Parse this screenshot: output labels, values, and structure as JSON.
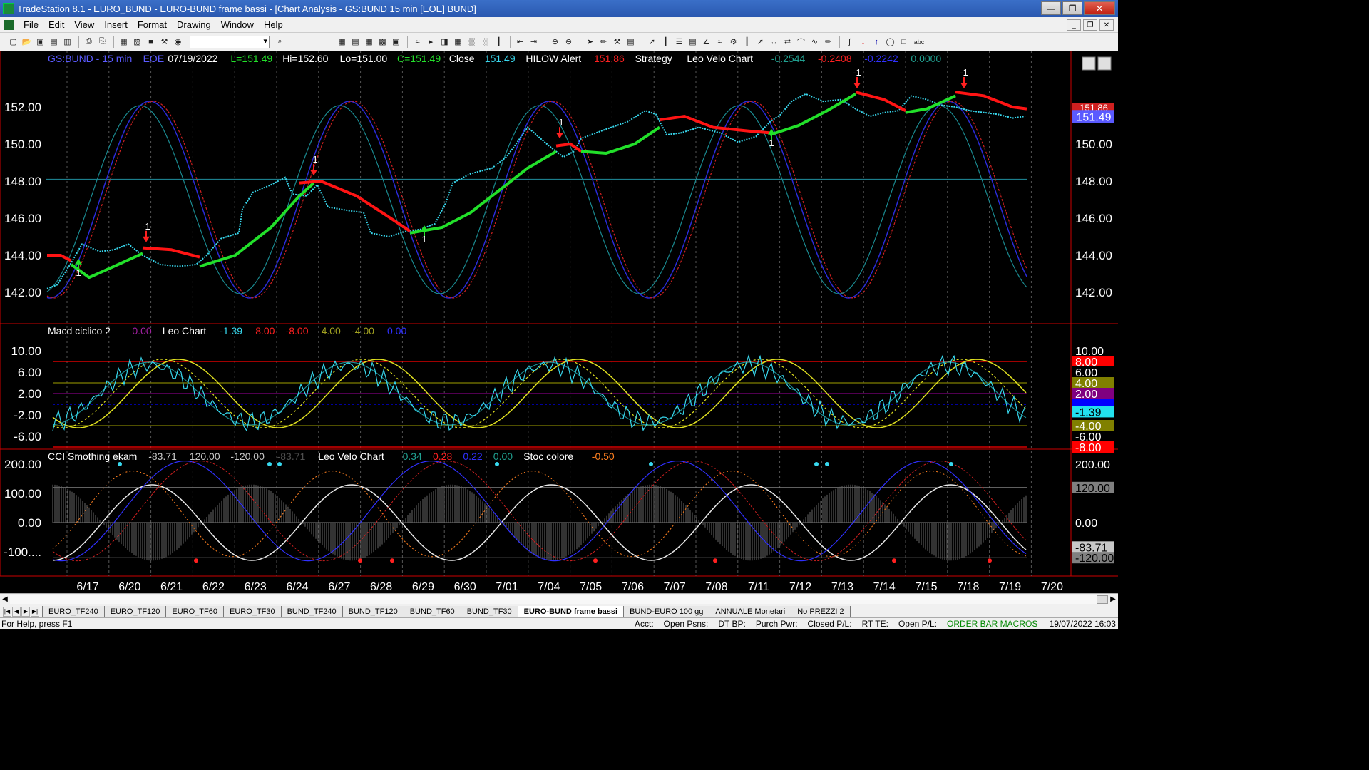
{
  "window": {
    "title": "TradeStation 8.1 - EURO_BUND - EURO-BUND frame bassi - [Chart Analysis - GS:BUND  15 min  [EOE] BUND]"
  },
  "menu": [
    "File",
    "Edit",
    "View",
    "Insert",
    "Format",
    "Drawing",
    "Window",
    "Help"
  ],
  "colors": {
    "price": "#38d8ee",
    "uptrend": "#22e02a",
    "downtrend": "#ff1414",
    "axis_text": "#ffffff",
    "panel_border": "#cc0000"
  },
  "price_panel": {
    "header": [
      {
        "text": "GS:BUND - 15 min",
        "color": "#5a5aff"
      },
      {
        "text": "EOE",
        "color": "#5a5aff"
      },
      {
        "text": "07/19/2022",
        "color": "#ffffff"
      },
      {
        "text": "L=151.49",
        "color": "#22e02a"
      },
      {
        "text": "Hi=152.60",
        "color": "#ffffff"
      },
      {
        "text": "Lo=151.00",
        "color": "#ffffff"
      },
      {
        "text": "C=151.49",
        "color": "#22e02a"
      },
      {
        "text": "Close",
        "color": "#ffffff"
      },
      {
        "text": "151.49",
        "color": "#38d8ee"
      },
      {
        "text": "HILOW Alert",
        "color": "#ffffff"
      },
      {
        "text": "151.86",
        "color": "#ff2020"
      },
      {
        "text": "Strategy",
        "color": "#ffffff"
      },
      {
        "text": "Leo Velo Chart",
        "color": "#ffffff"
      },
      {
        "text": "-0.2544",
        "color": "#20a090"
      },
      {
        "text": "-0.2408",
        "color": "#ff2020"
      },
      {
        "text": "-0.2242",
        "color": "#3030ff"
      },
      {
        "text": "0.0000",
        "color": "#20a090"
      }
    ],
    "y_ticks": [
      "152.00",
      "150.00",
      "148.00",
      "146.00",
      "144.00",
      "142.00"
    ],
    "last_price_tag": "151.49",
    "hidden_tag": "151.86"
  },
  "macd_panel": {
    "header": [
      {
        "text": "Macd ciclico 2",
        "color": "#ffffff"
      },
      {
        "text": "0.00",
        "color": "#a020a0"
      },
      {
        "text": "Leo Chart",
        "color": "#ffffff"
      },
      {
        "text": "-1.39",
        "color": "#38d8ee"
      },
      {
        "text": "8.00",
        "color": "#ff2020"
      },
      {
        "text": "-8.00",
        "color": "#ff2020"
      },
      {
        "text": "4.00",
        "color": "#a0a020"
      },
      {
        "text": "-4.00",
        "color": "#a0a020"
      },
      {
        "text": "0.00",
        "color": "#3030ff"
      }
    ],
    "y_ticks": [
      "10.00",
      "6.00",
      "2.00",
      "-2.00",
      "-6.00"
    ],
    "tags": [
      {
        "text": "10.00",
        "bg": "#000000",
        "fg": "#ffffff"
      },
      {
        "text": "8.00",
        "bg": "#ff0000",
        "fg": "#ffffff"
      },
      {
        "text": "6.00",
        "bg": "#000000",
        "fg": "#ffffff"
      },
      {
        "text": "4.00",
        "bg": "#808000",
        "fg": "#ffffff"
      },
      {
        "text": "2.00",
        "bg": "#800080",
        "fg": "#ffffff"
      },
      {
        "text": "0.00",
        "bg": "#0000ff",
        "fg": "#0000ff"
      },
      {
        "text": "-1.39",
        "bg": "#22e0ee",
        "fg": "#000000"
      },
      {
        "text": "-4.00",
        "bg": "#808000",
        "fg": "#ffffff"
      },
      {
        "text": "-6.00",
        "bg": "#000000",
        "fg": "#ffffff"
      },
      {
        "text": "-8.00",
        "bg": "#ff0000",
        "fg": "#ffffff"
      }
    ]
  },
  "cci_panel": {
    "header": [
      {
        "text": "CCI Smothing ekam",
        "color": "#ffffff"
      },
      {
        "text": "-83.71",
        "color": "#c8c8c8"
      },
      {
        "text": "120.00",
        "color": "#c8c8c8"
      },
      {
        "text": "-120.00",
        "color": "#c8c8c8"
      },
      {
        "text": "-83.71",
        "color": "#505050"
      },
      {
        "text": "Leo Velo Chart",
        "color": "#ffffff"
      },
      {
        "text": "0.34",
        "color": "#20a090"
      },
      {
        "text": "0.28",
        "color": "#ff2020"
      },
      {
        "text": "0.22",
        "color": "#3030ff"
      },
      {
        "text": "0.00",
        "color": "#20a090"
      },
      {
        "text": "Stoc colore",
        "color": "#ffffff"
      },
      {
        "text": "-0.50",
        "color": "#ff8020"
      }
    ],
    "y_ticks": [
      "200.00",
      "100.00",
      "0.00",
      "-100...."
    ],
    "tags": [
      {
        "text": "200.00",
        "bg": "#000000",
        "fg": "#ffffff"
      },
      {
        "text": "120.00",
        "bg": "#808080",
        "fg": "#000000"
      },
      {
        "text": "0.00",
        "bg": "#000000",
        "fg": "#ffffff"
      },
      {
        "text": "-83.71",
        "bg": "#c8c8c8",
        "fg": "#000000"
      },
      {
        "text": "-120.00",
        "bg": "#808080",
        "fg": "#000000"
      }
    ]
  },
  "x_labels": [
    "6/17",
    "6/20",
    "6/21",
    "6/22",
    "6/23",
    "6/24",
    "6/27",
    "6/28",
    "6/29",
    "6/30",
    "7/01",
    "7/04",
    "7/05",
    "7/06",
    "7/07",
    "7/08",
    "7/11",
    "7/12",
    "7/13",
    "7/14",
    "7/15",
    "7/18",
    "7/19",
    "7/20"
  ],
  "signals": [
    {
      "label": "-1",
      "type": "sell"
    },
    {
      "label": "-1",
      "type": "sell"
    },
    {
      "label": "-1",
      "type": "sell"
    },
    {
      "label": "-1",
      "type": "sell"
    },
    {
      "label": "-1",
      "type": "sell"
    },
    {
      "label": "1",
      "type": "buy"
    },
    {
      "label": "1",
      "type": "buy"
    },
    {
      "label": "1",
      "type": "buy"
    }
  ],
  "tabs": [
    "EURO_TF240",
    "EURO_TF120",
    "EURO_TF60",
    "EURO_TF30",
    "BUND_TF240",
    "BUND_TF120",
    "BUND_TF60",
    "BUND_TF30",
    "EURO-BUND frame bassi",
    "BUND-EURO 100 gg",
    "ANNUALE Monetari",
    "No PREZZI 2"
  ],
  "active_tab": "EURO-BUND frame bassi",
  "status": {
    "help": "For Help, press F1",
    "fields": [
      "Acct:",
      "Open Psns:",
      "DT BP:",
      "Purch Pwr:",
      "Closed P/L:",
      "RT TE:",
      "Open P/L:"
    ],
    "order_macros": "ORDER BAR  MACROS",
    "datetime": "19/07/2022 16:03"
  }
}
